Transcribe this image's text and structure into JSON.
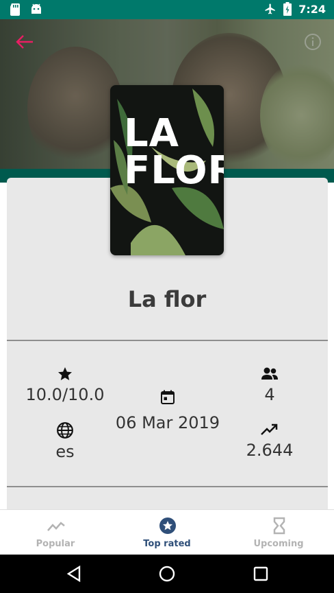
{
  "status_bar": {
    "time": "7:24"
  },
  "movie": {
    "title": "La flor",
    "poster_text": "LA FLOR",
    "rating": "10.0/10.0",
    "release_date": "06 Mar 2019",
    "vote_count": "4",
    "language": "es",
    "popularity": "2.644"
  },
  "bottom_nav": {
    "items": [
      {
        "label": "Popular",
        "icon": "trending-icon",
        "active": false
      },
      {
        "label": "Top rated",
        "icon": "star-circle-icon",
        "active": true
      },
      {
        "label": "Upcoming",
        "icon": "hourglass-icon",
        "active": false
      }
    ]
  },
  "colors": {
    "status_bar": "#00796b",
    "accent": "#e91e63",
    "active_nav": "#2f4f79",
    "inactive_nav": "#b3b3b3"
  }
}
